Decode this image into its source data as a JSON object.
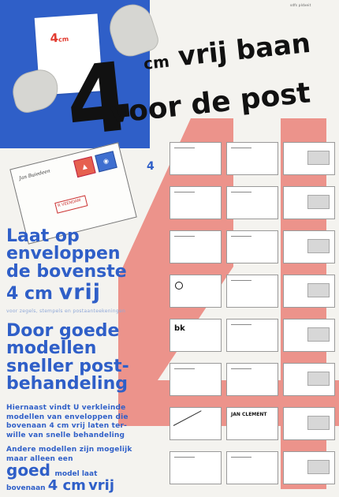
{
  "poster": {
    "credit": "sdfs pldxeit",
    "card_label": {
      "number": "4",
      "unit": "cm"
    },
    "headline": {
      "big_number": "4",
      "unit": "cm",
      "line1": "vrij baan",
      "line2": "voor de post"
    },
    "envelope": {
      "signature": "Jan Buiedeen",
      "stamp1": "▲",
      "stamp2": "◉",
      "registered": "R  VEENDAM"
    },
    "blue_4_label": "4",
    "copy": {
      "laat_line1": "Laat op",
      "laat_line2": "enveloppen",
      "laat_line3": "de bovenste",
      "four_cm": "4 cm",
      "vrij": "vrij",
      "small_note": "voor zegels, stempels en postaanteekeningen",
      "door_line1": "Door goede",
      "door_line2": "modellen",
      "door_line3": "sneller post-",
      "door_line4": "behandeling",
      "para_line1": "Hiernaast vindt U verkleinde",
      "para_line2": "modellen van enveloppen die",
      "para_line3": "bovenaan 4 cm vrij laten ter-",
      "para_line4": "wille van snelle behandeling",
      "para2_line1": "Andere modellen zijn mogelijk",
      "para2_line2": "maar alleen een",
      "goed": "goed",
      "goed_suffix": "model laat",
      "final_prefix": "bovenaan",
      "final_4cm": "4 cm",
      "final_vrij": "vrij"
    },
    "sample_cards": {
      "bk_text": "bk",
      "jan_clement_text": "JAN CLEMENT"
    },
    "colors": {
      "blue": "#2f5fc8",
      "red": "#e85a4f",
      "black": "#111111",
      "paper": "#f4f3ef"
    }
  }
}
